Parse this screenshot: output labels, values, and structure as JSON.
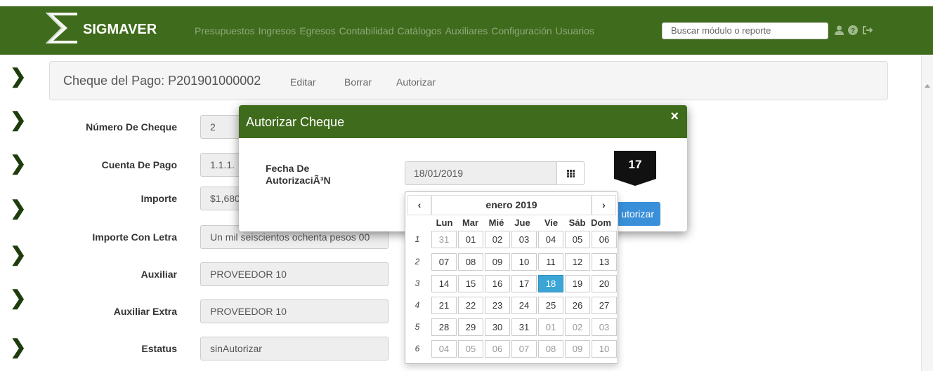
{
  "app": {
    "brand": "SIGMAVER"
  },
  "nav": {
    "items": [
      "Presupuestos",
      "Ingresos",
      "Egresos",
      "Contabilidad",
      "Catálogos",
      "Auxiliares",
      "Configuración",
      "Usuarios"
    ],
    "search_value": "Buscar módulo o reporte",
    "icons": [
      "user-icon",
      "help-icon",
      "logout-icon"
    ]
  },
  "page": {
    "title": "Cheque del Pago: P201901000002",
    "actions": {
      "edit": "Editar",
      "delete": "Borrar",
      "authorize": "Autorizar"
    }
  },
  "form": {
    "rows": [
      {
        "label": "Número De Cheque",
        "value": "2"
      },
      {
        "label": "Cuenta De Pago",
        "value": "1.1.1."
      },
      {
        "label": "Importe",
        "value": "$1,680"
      },
      {
        "label": "Importe Con Letra",
        "value": "Un mil seiscientos ochenta pesos 00"
      },
      {
        "label": "Auxiliar",
        "value": "PROVEEDOR 10"
      },
      {
        "label": "Auxiliar Extra",
        "value": "PROVEEDOR 10"
      },
      {
        "label": "Estatus",
        "value": "sinAutorizar"
      }
    ]
  },
  "modal": {
    "title": "Autorizar Cheque",
    "close": "×",
    "field_label": "Fecha De AutorizaciÃ³N",
    "date_value": "18/01/2019",
    "badge": "17",
    "button": "utorizar"
  },
  "calendar": {
    "month_label": "enero 2019",
    "prev": "‹",
    "next": "›",
    "weekdays": [
      "Lun",
      "Mar",
      "Mié",
      "Jue",
      "Vie",
      "Sáb",
      "Dom"
    ],
    "weeks": [
      {
        "num": "1",
        "days": [
          "31",
          "01",
          "02",
          "03",
          "04",
          "05",
          "06"
        ]
      },
      {
        "num": "2",
        "days": [
          "07",
          "08",
          "09",
          "10",
          "11",
          "12",
          "13"
        ]
      },
      {
        "num": "3",
        "days": [
          "14",
          "15",
          "16",
          "17",
          "18",
          "19",
          "20"
        ]
      },
      {
        "num": "4",
        "days": [
          "21",
          "22",
          "23",
          "24",
          "25",
          "26",
          "27"
        ]
      },
      {
        "num": "5",
        "days": [
          "28",
          "29",
          "30",
          "31",
          "01",
          "02",
          "03"
        ]
      },
      {
        "num": "6",
        "days": [
          "04",
          "05",
          "06",
          "07",
          "08",
          "09",
          "10"
        ]
      }
    ],
    "selected": "18"
  }
}
